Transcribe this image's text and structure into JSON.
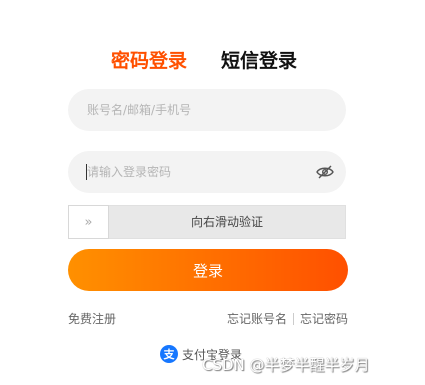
{
  "tabs": {
    "password_login": "密码登录",
    "sms_login": "短信登录"
  },
  "account": {
    "placeholder": "账号名/邮箱/手机号"
  },
  "password": {
    "placeholder": "请输入登录密码",
    "toggle_icon": "eye-closed-icon"
  },
  "slider": {
    "handle_glyph": "»",
    "text": "向右滑动验证"
  },
  "login_button": "登录",
  "links": {
    "register": "免费注册",
    "forgot_account": "忘记账号名",
    "forgot_password": "忘记密码"
  },
  "alipay": {
    "icon_glyph": "支",
    "label": "支付宝登录"
  },
  "watermark": "CSDN @半梦半醒半岁月",
  "colors": {
    "accent": "#ff5000",
    "gradient_start": "#ff9000",
    "alipay_blue": "#1677ff"
  }
}
